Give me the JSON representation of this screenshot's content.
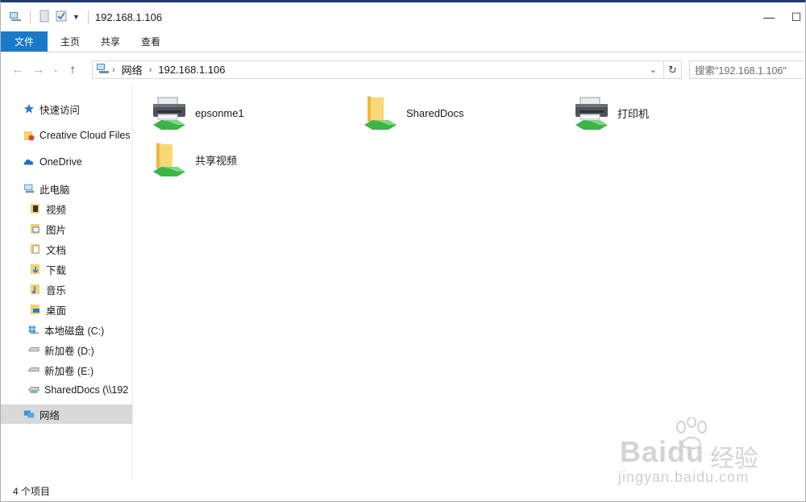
{
  "titlebar": {
    "title": "192.168.1.106",
    "minimize": "—",
    "maximize": "☐"
  },
  "ribbon": {
    "tabs": [
      {
        "label": "文件"
      },
      {
        "label": "主页"
      },
      {
        "label": "共享"
      },
      {
        "label": "查看"
      }
    ]
  },
  "address": {
    "crumbs": [
      "网络",
      "192.168.1.106"
    ],
    "search_placeholder": "搜索\"192.168.1.106\""
  },
  "sidebar": {
    "items": [
      {
        "label": "快速访问",
        "icon": "star-icon"
      },
      {
        "label": "Creative Cloud Files",
        "icon": "creative-cloud-folder-icon"
      },
      {
        "label": "OneDrive",
        "icon": "onedrive-cloud-icon"
      },
      {
        "label": "此电脑",
        "icon": "computer-icon"
      },
      {
        "label": "视频",
        "icon": "videos-folder-icon"
      },
      {
        "label": "图片",
        "icon": "pictures-folder-icon"
      },
      {
        "label": "文档",
        "icon": "documents-folder-icon"
      },
      {
        "label": "下载",
        "icon": "downloads-folder-icon"
      },
      {
        "label": "音乐",
        "icon": "music-folder-icon"
      },
      {
        "label": "桌面",
        "icon": "desktop-folder-icon"
      },
      {
        "label": "本地磁盘 (C:)",
        "icon": "windows-drive-icon"
      },
      {
        "label": "新加卷 (D:)",
        "icon": "drive-icon"
      },
      {
        "label": "新加卷 (E:)",
        "icon": "drive-icon"
      },
      {
        "label": "SharedDocs (\\\\192",
        "icon": "network-drive-icon"
      },
      {
        "label": "网络",
        "icon": "network-icon"
      }
    ]
  },
  "content": {
    "items": [
      {
        "label": "epsonme1",
        "icon": "shared-printer-icon"
      },
      {
        "label": "SharedDocs",
        "icon": "shared-folder-icon"
      },
      {
        "label": "打印机",
        "icon": "shared-printer-icon"
      },
      {
        "label": "共享视频",
        "icon": "shared-folder-icon"
      }
    ]
  },
  "status": {
    "count": "4 个项目"
  },
  "watermark": {
    "brand": "Baidu",
    "cn": "经验",
    "url": "jingyan.baidu.com"
  },
  "colors": {
    "accent": "#1979ca",
    "selection": "#d9d9d9",
    "folder": "#f5d06e",
    "share_green": "#3bb54a"
  }
}
